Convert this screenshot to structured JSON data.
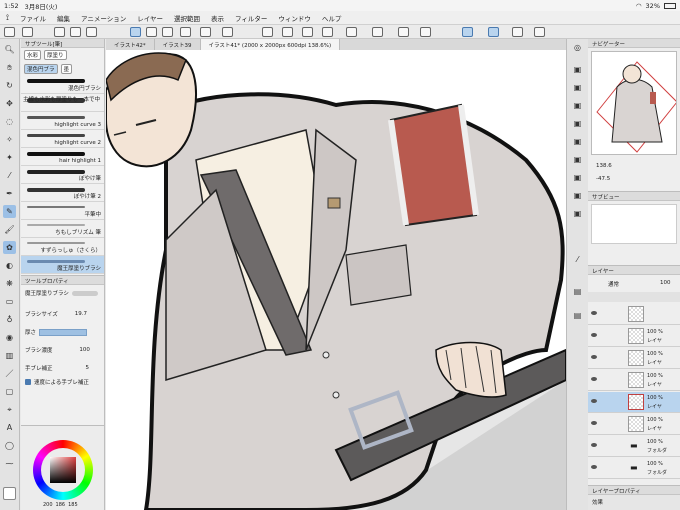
{
  "status": {
    "time": "1:52",
    "date": "3月8日(火)",
    "battery": "32%"
  },
  "menu": [
    "ファイル",
    "編集",
    "アニメーション",
    "レイヤー",
    "選択範囲",
    "表示",
    "フィルター",
    "ウィンドウ",
    "ヘルプ"
  ],
  "subtool": {
    "title": "サブツール[筆]",
    "tabs": [
      "水彩",
      "厚塗り",
      "混色円ブラ",
      "墨"
    ],
    "brushes": [
      "混色円ブラシ",
      "主線も水彩も厚塗りも一本で中",
      "highlight curve 3",
      "highlight curve 2",
      "hair highlight 1",
      "ぼやけ筆",
      "ぼやけ筆 2",
      "平筆中",
      "ちもしブリズム 筆",
      "すずらっしゅ（さくら）",
      "魔王厚塗りブラシ"
    ]
  },
  "toolprop": {
    "title": "ツールプロパティ",
    "brushname": "魔王厚塗りブラシ",
    "size_label": "ブラシサイズ",
    "size_value": "19.7",
    "thickness_label": "厚さ",
    "density_label": "ブラシ濃度",
    "density_value": "100",
    "stabilize_label": "手ブレ補正",
    "stabilize_value": "5",
    "speed_label": "速度による手ブレ補正"
  },
  "color": {
    "r": "200",
    "g": "186",
    "b": "185",
    "main": "#c8bab9"
  },
  "doctabs": [
    "イラスト42*",
    "イラスト39",
    "イラスト41* (2000 x 2000px 600dpi 138.6%)"
  ],
  "navigator": {
    "title": "ナビゲーター",
    "zoom": "138.6",
    "angle": "-47.5"
  },
  "subview": {
    "title": "サブビュー"
  },
  "layers": {
    "title": "レイヤー",
    "blend": "通常",
    "opacity": "100",
    "items": [
      {
        "pct": "",
        "name": ""
      },
      {
        "pct": "100 %",
        "name": "レイヤ"
      },
      {
        "pct": "100 %",
        "name": "レイヤ"
      },
      {
        "pct": "100 %",
        "name": "レイヤ"
      },
      {
        "pct": "100 %",
        "name": "レイヤ"
      },
      {
        "pct": "100 %",
        "name": "レイヤ"
      },
      {
        "pct": "100 %",
        "name": "フォルダ"
      },
      {
        "pct": "100 %",
        "name": "フォルダ"
      }
    ],
    "footer": "レイヤープロパティ",
    "effect": "効果"
  }
}
